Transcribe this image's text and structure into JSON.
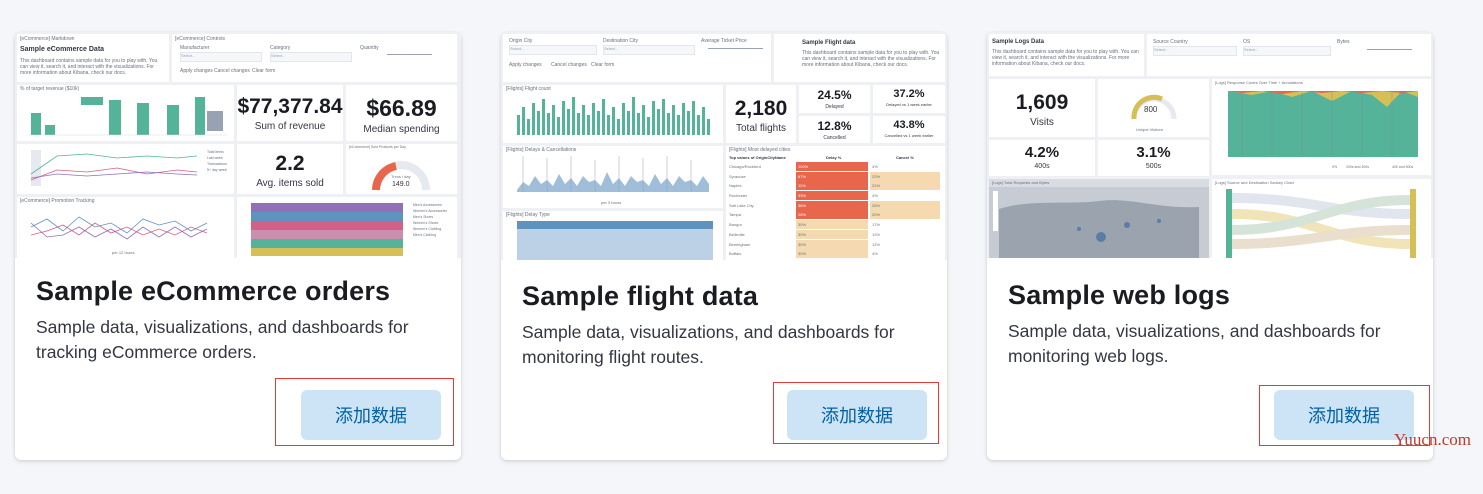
{
  "cards": [
    {
      "title": "Sample eCommerce orders",
      "description": "Sample data, visualizations, and dashboards for tracking eCommerce orders.",
      "button_label": "添加数据",
      "thumbnail": {
        "markdown_title": "[eCommerce] Markdown",
        "dashboard_title": "Sample eCommerce Data",
        "intro": "This dashboard contains sample data for you to play with. You can view it, search it, and interact with the visualizations. For more information about Kibana, check our docs.",
        "controls_title": "[eCommerce] Controls",
        "control_labels": [
          "Manufacturer",
          "Category",
          "Quantity"
        ],
        "select_placeholder": "Select...",
        "control_buttons": [
          "Apply changes",
          "Cancel changes",
          "Clear form"
        ],
        "chart1_title": "% of target revenue ($10k)",
        "revenue_value": "$77,377.84",
        "revenue_label": "Sum of revenue",
        "median_value": "$66.89",
        "median_label": "Median spending",
        "items_value": "2.2",
        "items_label": "Avg. items sold",
        "gauge_title": "[eCommerce] Sold Products per Day",
        "gauge_label": "Trxns / day",
        "gauge_value": "149.0",
        "legend": [
          "Total items",
          "Last week",
          "Transactions",
          "5+ day week"
        ],
        "promo_title": "[eCommerce] Promotion Tracking",
        "axis_note": "per 12 hours",
        "stack_legend": [
          "Men's Accessories",
          "Women's Accessories",
          "Men's Shoes",
          "Women's Shoes",
          "Women's Clothing",
          "Men's Clothing"
        ]
      }
    },
    {
      "title": "Sample flight data",
      "description": "Sample data, visualizations, and dashboards for monitoring flight routes.",
      "button_label": "添加数据",
      "thumbnail": {
        "control_labels": [
          "Origin City",
          "Destination City",
          "Average Ticket Price"
        ],
        "select_placeholder": "Select...",
        "control_buttons": [
          "Apply changes",
          "Cancel changes",
          "Clear form"
        ],
        "markdown_title": "Sample Flight data",
        "intro": "This dashboard contains sample data for you to play with. You can view it, search it, and interact with the visualizations. For more information about Kibana, check our docs.",
        "chart1_title": "[Flights] Flight count",
        "total_value": "2,180",
        "total_label": "Total flights",
        "delayed_pct": "24.5%",
        "delayed_label": "Delayed",
        "delayed_week_pct": "37.2%",
        "delayed_week_label": "Delayed vs 1 week earlier",
        "cancelled_pct": "12.8%",
        "cancelled_label": "Cancelled",
        "cancelled_week_pct": "43.8%",
        "cancelled_week_label": "Cancelled vs 1 week earlier",
        "chart2_title": "[Flights] Delays & Cancellations",
        "chart2_axis": "per 3 hours",
        "chart3_title": "[Flights] Delay Type",
        "table_title": "[Flights] Most delayed cities",
        "table_headers": [
          "Top values of OriginCityName",
          "Delay %",
          "Cancel %"
        ],
        "table_rows": [
          [
            "Chicago/Rockford",
            "100%",
            "4%"
          ],
          [
            "Syracuse",
            "67%",
            "22%"
          ],
          [
            "Naples",
            "11%",
            "21%"
          ],
          [
            "Rochester",
            "33%",
            "4%"
          ],
          [
            "Salt Lake City",
            "38%",
            "25%"
          ],
          [
            "Tampa",
            "28%",
            "20%"
          ],
          [
            "Bangor",
            "30%",
            "17%"
          ],
          [
            "Belleville",
            "30%",
            "12%"
          ],
          [
            "Birmingham",
            "30%",
            "12%"
          ],
          [
            "Buffalo",
            "30%",
            "4%"
          ]
        ]
      }
    },
    {
      "title": "Sample web logs",
      "description": "Sample data, visualizations, and dashboards for monitoring web logs.",
      "button_label": "添加数据",
      "thumbnail": {
        "markdown_title": "Sample Logs Data",
        "intro": "This dashboard contains sample data for you to play with. You can view it, search it, and interact with the visualizations. For more information about Kibana, check our docs.",
        "control_labels": [
          "Source Country",
          "OS",
          "Bytes"
        ],
        "select_placeholder": "Select...",
        "visits_value": "1,609",
        "visits_label": "Visits",
        "gauge_value": "800",
        "gauge_label": "Unique Visitors",
        "chart_title": "[Logs] Response Codes Over Time + Annotations",
        "err400_value": "4.2%",
        "err400_label": "400s",
        "err500_value": "3.1%",
        "err500_label": "500s",
        "map_title": "[Logs] Total Requests and Bytes",
        "sankey_title": "[Logs] Source and Destination Sankey Chart",
        "legend": [
          "0%",
          "200s and 300s",
          "400 and 500s"
        ]
      }
    }
  ],
  "watermark": "Yuucn.com",
  "colors": {
    "button_bg": "#cce4f5",
    "button_text": "#0061a6",
    "highlight": "#e53935",
    "chart_green": "#54b399",
    "chart_blue": "#6092c0",
    "chart_red": "#e7664c"
  }
}
